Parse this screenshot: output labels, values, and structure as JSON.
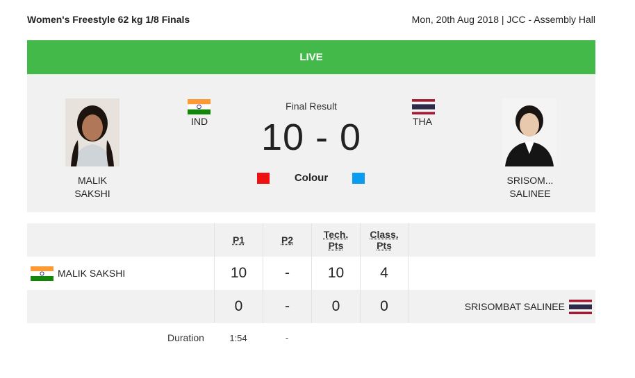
{
  "header": {
    "event": "Women's Freestyle 62 kg 1/8 Finals",
    "meta": "Mon, 20th Aug 2018 | JCC - Assembly Hall"
  },
  "live_label": "LIVE",
  "match": {
    "result_label": "Final Result",
    "score": "10 - 0",
    "colour_label": "Colour",
    "red": {
      "name_line1": "MALIK",
      "name_line2": "SAKSHI",
      "country": "IND",
      "color": "#ee1111"
    },
    "blue": {
      "name_line1": "SRISOM...",
      "name_line2": "SALINEE",
      "country": "THA",
      "color": "#0a9cf1"
    }
  },
  "table": {
    "headers": {
      "p1": "P1",
      "p2": "P2",
      "tech_1": "Tech.",
      "tech_2": "Pts",
      "class_1": "Class.",
      "class_2": "Pts"
    },
    "rows": [
      {
        "name": "MALIK SAKSHI",
        "p1": "10",
        "p2": "-",
        "tech": "10",
        "class": "4"
      },
      {
        "name": "SRISOMBAT SALINEE",
        "p1": "0",
        "p2": "-",
        "tech": "0",
        "class": "0"
      }
    ],
    "duration_label": "Duration",
    "duration_p1": "1:54",
    "duration_p2": "-"
  },
  "colors": {
    "live_green": "#43b94a",
    "panel_grey": "#f1f1f1"
  }
}
